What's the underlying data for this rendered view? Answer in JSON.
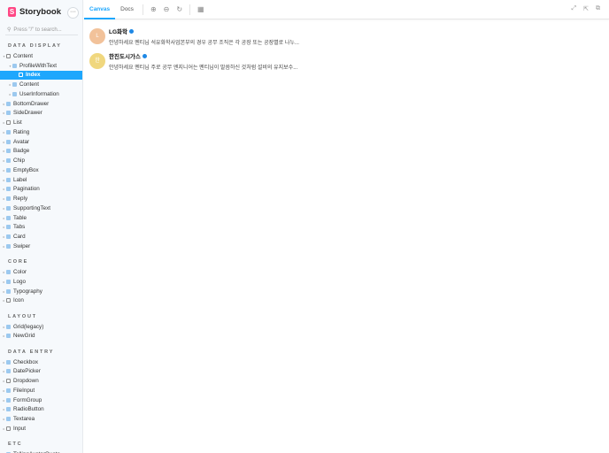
{
  "brand": {
    "name": "Storybook",
    "logo_letter": "S",
    "menu": "···"
  },
  "search": {
    "placeholder": "Press \"/\" to search..."
  },
  "sidebar": [
    {
      "section": "DATA DISPLAY",
      "items": [
        {
          "label": "Content",
          "level": 0,
          "icon": "folder",
          "caret": "▾"
        },
        {
          "label": "ProfileWithText",
          "level": 1,
          "icon": "comp",
          "caret": "▾"
        },
        {
          "label": "Index",
          "level": 2,
          "icon": "story",
          "selected": true
        },
        {
          "label": "Content",
          "level": 1,
          "icon": "comp",
          "caret": "▸"
        },
        {
          "label": "UserInformation",
          "level": 1,
          "icon": "comp",
          "caret": "▸"
        },
        {
          "label": "BottomDrawer",
          "level": 0,
          "icon": "comp",
          "caret": "▸"
        },
        {
          "label": "SideDrawer",
          "level": 0,
          "icon": "comp",
          "caret": "▸"
        },
        {
          "label": "List",
          "level": 0,
          "icon": "folder",
          "caret": "▸"
        },
        {
          "label": "Rating",
          "level": 0,
          "icon": "comp",
          "caret": "▸"
        },
        {
          "label": "Avatar",
          "level": 0,
          "icon": "comp",
          "caret": "▸"
        },
        {
          "label": "Badge",
          "level": 0,
          "icon": "comp",
          "caret": "▸"
        },
        {
          "label": "Chip",
          "level": 0,
          "icon": "comp",
          "caret": "▸"
        },
        {
          "label": "EmptyBox",
          "level": 0,
          "icon": "comp",
          "caret": "▸"
        },
        {
          "label": "Label",
          "level": 0,
          "icon": "comp",
          "caret": "▸"
        },
        {
          "label": "Pagination",
          "level": 0,
          "icon": "comp",
          "caret": "▸"
        },
        {
          "label": "Reply",
          "level": 0,
          "icon": "comp",
          "caret": "▸"
        },
        {
          "label": "SupportingText",
          "level": 0,
          "icon": "comp",
          "caret": "▸"
        },
        {
          "label": "Table",
          "level": 0,
          "icon": "comp",
          "caret": "▸"
        },
        {
          "label": "Tabs",
          "level": 0,
          "icon": "comp",
          "caret": "▸"
        },
        {
          "label": "Card",
          "level": 0,
          "icon": "comp",
          "caret": "▸"
        },
        {
          "label": "Swiper",
          "level": 0,
          "icon": "comp",
          "caret": "▸"
        }
      ]
    },
    {
      "section": "CORE",
      "items": [
        {
          "label": "Color",
          "level": 0,
          "icon": "comp",
          "caret": "▸"
        },
        {
          "label": "Logo",
          "level": 0,
          "icon": "comp",
          "caret": "▸"
        },
        {
          "label": "Typography",
          "level": 0,
          "icon": "comp",
          "caret": "▸"
        },
        {
          "label": "Icon",
          "level": 0,
          "icon": "folder",
          "caret": "▸"
        }
      ]
    },
    {
      "section": "LAYOUT",
      "items": [
        {
          "label": "Grid(legacy)",
          "level": 0,
          "icon": "comp",
          "caret": "▸"
        },
        {
          "label": "NewGrid",
          "level": 0,
          "icon": "comp",
          "caret": "▸"
        }
      ]
    },
    {
      "section": "DATA ENTRY",
      "items": [
        {
          "label": "Checkbox",
          "level": 0,
          "icon": "comp",
          "caret": "▸"
        },
        {
          "label": "DatePicker",
          "level": 0,
          "icon": "comp",
          "caret": "▸"
        },
        {
          "label": "Dropdown",
          "level": 0,
          "icon": "folder",
          "caret": "▸"
        },
        {
          "label": "FileInput",
          "level": 0,
          "icon": "comp",
          "caret": "▸"
        },
        {
          "label": "FormGroup",
          "level": 0,
          "icon": "comp",
          "caret": "▸"
        },
        {
          "label": "RadioButton",
          "level": 0,
          "icon": "comp",
          "caret": "▸"
        },
        {
          "label": "Textarea",
          "level": 0,
          "icon": "comp",
          "caret": "▸"
        },
        {
          "label": "Input",
          "level": 0,
          "icon": "folder",
          "caret": "▸"
        }
      ]
    },
    {
      "section": "ETC",
      "items": [
        {
          "label": "TellingAvatarQuote",
          "level": 0,
          "icon": "comp",
          "caret": "▸"
        }
      ]
    }
  ],
  "toolbar": {
    "tabs": [
      "Canvas",
      "Docs"
    ]
  },
  "items": [
    {
      "initial": "L",
      "color": "#f2c29a",
      "name": "LG화학",
      "message": "안녕하세요 멘티님 석유화학사업본부의 경우 공무 조직은 각 공장 또는 공장별로 나누..."
    },
    {
      "initial": "한",
      "color": "#f0d77e",
      "name": "한진도시가스",
      "message": "안녕하세요 멘티님 주로 공무 엔지니어는 멘티님이 말씀하신 것처럼 설비의 유지보수..."
    }
  ]
}
